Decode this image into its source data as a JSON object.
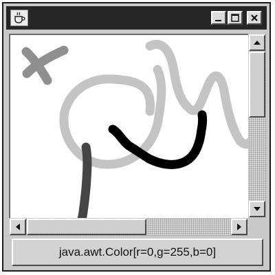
{
  "window": {
    "status_text": "java.awt.Color[r=0,g=255,b=0]"
  },
  "title_bar": {
    "app_icon": "java-coffee-cup-icon",
    "buttons": [
      "minimize-icon",
      "maximize-icon",
      "close-icon"
    ]
  },
  "scrollbars": {
    "vertical": {
      "icons": [
        "arrow-up-icon",
        "arrow-down-icon"
      ]
    },
    "horizontal": {
      "icons": [
        "arrow-left-icon",
        "arrow-right-icon"
      ]
    }
  },
  "canvas": {
    "strokes": [
      {
        "name": "x-mark-stroke",
        "color": "#8f8f8f"
      },
      {
        "name": "large-loop-stroke",
        "color": "#c4c4c4"
      },
      {
        "name": "top-right-wave-stroke",
        "color": "#c4c4c4"
      },
      {
        "name": "dark-vertical-stroke",
        "color": "#454545"
      },
      {
        "name": "black-curve-stroke",
        "color": "#000000"
      }
    ]
  }
}
